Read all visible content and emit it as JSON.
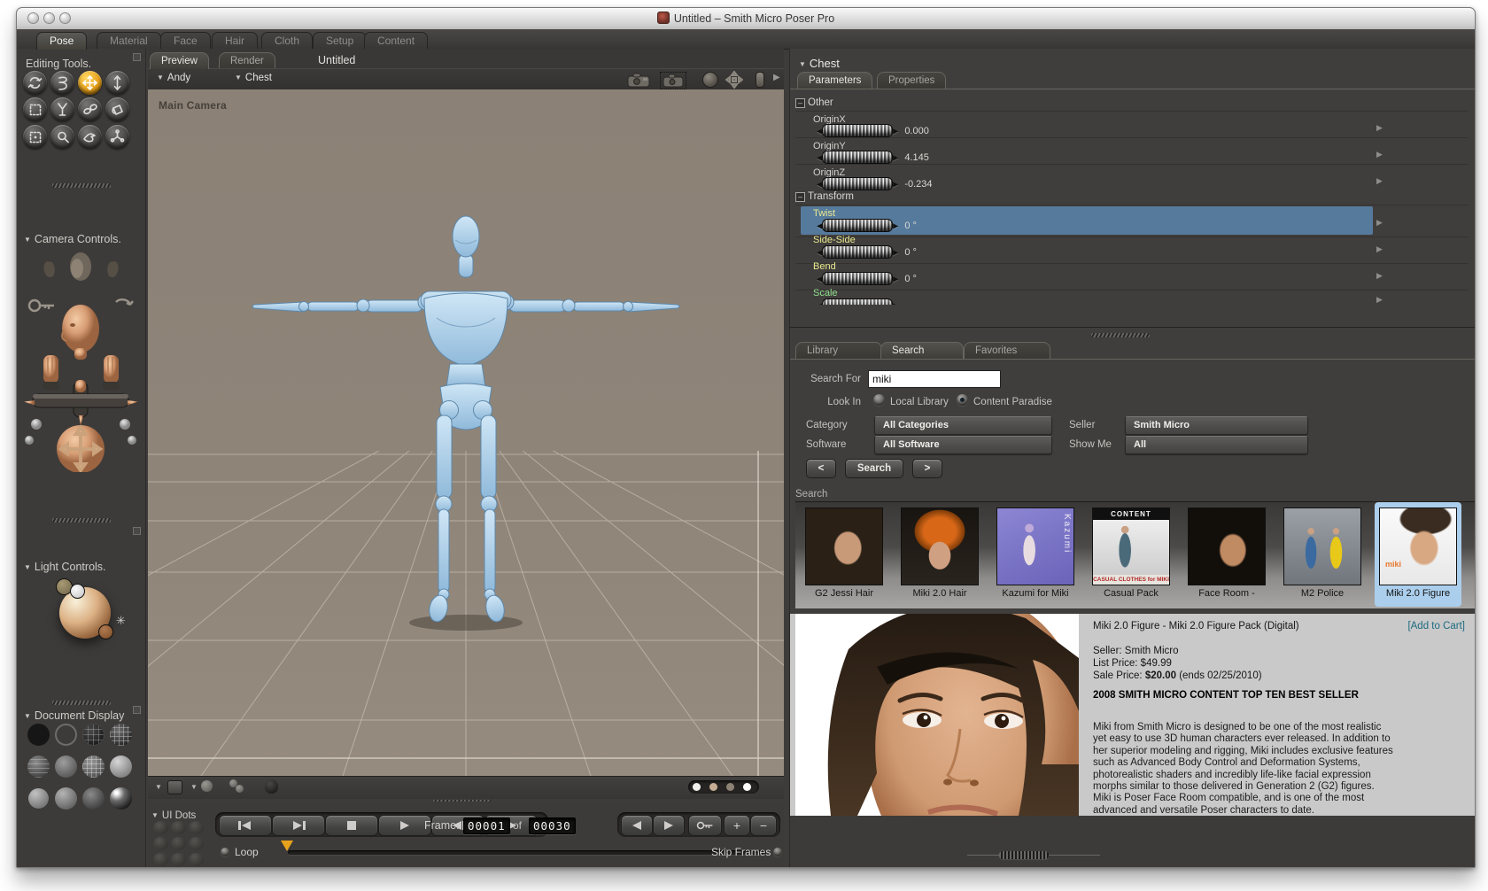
{
  "window": {
    "title": "Untitled – Smith Micro Poser Pro"
  },
  "app_tabs": [
    "Pose",
    "Material",
    "Face",
    "Hair",
    "Cloth",
    "Setup",
    "Content"
  ],
  "sidebar": {
    "editing_tools_title": "Editing Tools.",
    "tools": [
      "rotate",
      "twist",
      "translate-pull",
      "translate-in-out",
      "scale",
      "taper",
      "chain-break",
      "color",
      "grouping",
      "view-magnifier",
      "morphing-tool",
      "direct-manipulation"
    ],
    "selected_tool": "translate-pull",
    "camera_controls_title": "Camera Controls.",
    "light_controls_title": "Light Controls.",
    "document_display_title": "Document Display"
  },
  "viewport": {
    "tab_preview": "Preview",
    "tab_render": "Render",
    "document_name": "Untitled",
    "figure_menu": "Andy",
    "actor_menu": "Chest",
    "camera_name": "Main Camera",
    "header_icons": [
      "camera-flyaround",
      "camera-select",
      "trackball",
      "camera-move",
      "camera-bank"
    ]
  },
  "animation": {
    "ui_dots_label": "UI Dots",
    "transport": [
      "first-frame",
      "last-frame",
      "stop",
      "play",
      "step-back",
      "step-forward"
    ],
    "frame_label": "Frame:",
    "frame_current": "00001",
    "of_label": "of",
    "frame_total": "00030",
    "edit_buttons": [
      "previous-keyframe",
      "next-keyframe",
      "edit-keyframes"
    ],
    "plus_label": "+",
    "minus_label": "−",
    "loop_label": "Loop",
    "skip_frames_label": "Skip Frames"
  },
  "parameters": {
    "actor_title": "Chest",
    "tabs": [
      "Parameters",
      "Properties"
    ],
    "groups": [
      {
        "name": "Other",
        "rows": [
          {
            "label": "OriginX",
            "value": "0.000"
          },
          {
            "label": "OriginY",
            "value": "4.145"
          },
          {
            "label": "OriginZ",
            "value": "-0.234"
          }
        ]
      },
      {
        "name": "Transform",
        "rows": [
          {
            "label": "Twist",
            "value": "0 °"
          },
          {
            "label": "Side-Side",
            "value": "0 °"
          },
          {
            "label": "Bend",
            "value": "0 °"
          },
          {
            "label": "Scale",
            "value": ""
          }
        ]
      }
    ]
  },
  "library": {
    "tabs": [
      "Library",
      "Search",
      "Favorites"
    ],
    "search_for_label": "Search For",
    "search_value": "miki",
    "look_in_label": "Look In",
    "option_local": "Local Library",
    "option_paradise": "Content Paradise",
    "category_label": "Category",
    "category_value": "All Categories",
    "seller_label": "Seller",
    "seller_value": "Smith Micro",
    "software_label": "Software",
    "software_value": "All Software",
    "show_me_label": "Show Me",
    "show_me_value": "All",
    "prev_button": "<",
    "search_button": "Search",
    "next_button": ">",
    "results_title": "Search",
    "results": [
      {
        "label": "G2 Jessi Hair"
      },
      {
        "label": "Miki 2.0 Hair"
      },
      {
        "label": "Kazumi for Miki",
        "overlay": "Kazumi"
      },
      {
        "label": "Casual Pack",
        "overlay_top": "CONTENT",
        "overlay_bottom": "CASUAL CLOTHES for MIKI"
      },
      {
        "label": "Face Room -"
      },
      {
        "label": "M2 Police"
      },
      {
        "label": "Miki 2.0 Figure",
        "overlay": "miki"
      }
    ]
  },
  "product": {
    "title": "Miki 2.0 Figure - Miki 2.0 Figure Pack (Digital)",
    "add_to_cart": "[Add to Cart]",
    "seller": "Seller: Smith Micro",
    "list_price": "List Price: $49.99",
    "sale_price_label": "Sale Price:",
    "sale_price_value": "$20.00",
    "sale_price_ends": "(ends 02/25/2010)",
    "headline": "2008 SMITH MICRO CONTENT TOP TEN BEST SELLER",
    "description_lines": [
      "Miki from Smith Micro is designed to be one of the most realistic",
      "yet easy to use 3D human characters ever released. In addition to",
      "her superior modeling and rigging, Miki includes exclusive features",
      "such as Advanced Body Control and Deformation Systems,",
      "photorealistic shaders and incredibly life-like facial expression",
      "morphs similar to those delivered in Generation 2 (G2) figures.",
      "Miki is Poser Face Room compatible, and is one of the most",
      "advanced and versatile Poser characters to date."
    ]
  },
  "colors": {
    "accent_orange": "#e8a21c",
    "param_highlight": "#567a9c",
    "selected_thumb": "#abceec",
    "add_to_cart_teal": "#1d6b80",
    "param_label_yellow": "#e9e98e",
    "param_label_green": "#8fe08f"
  }
}
